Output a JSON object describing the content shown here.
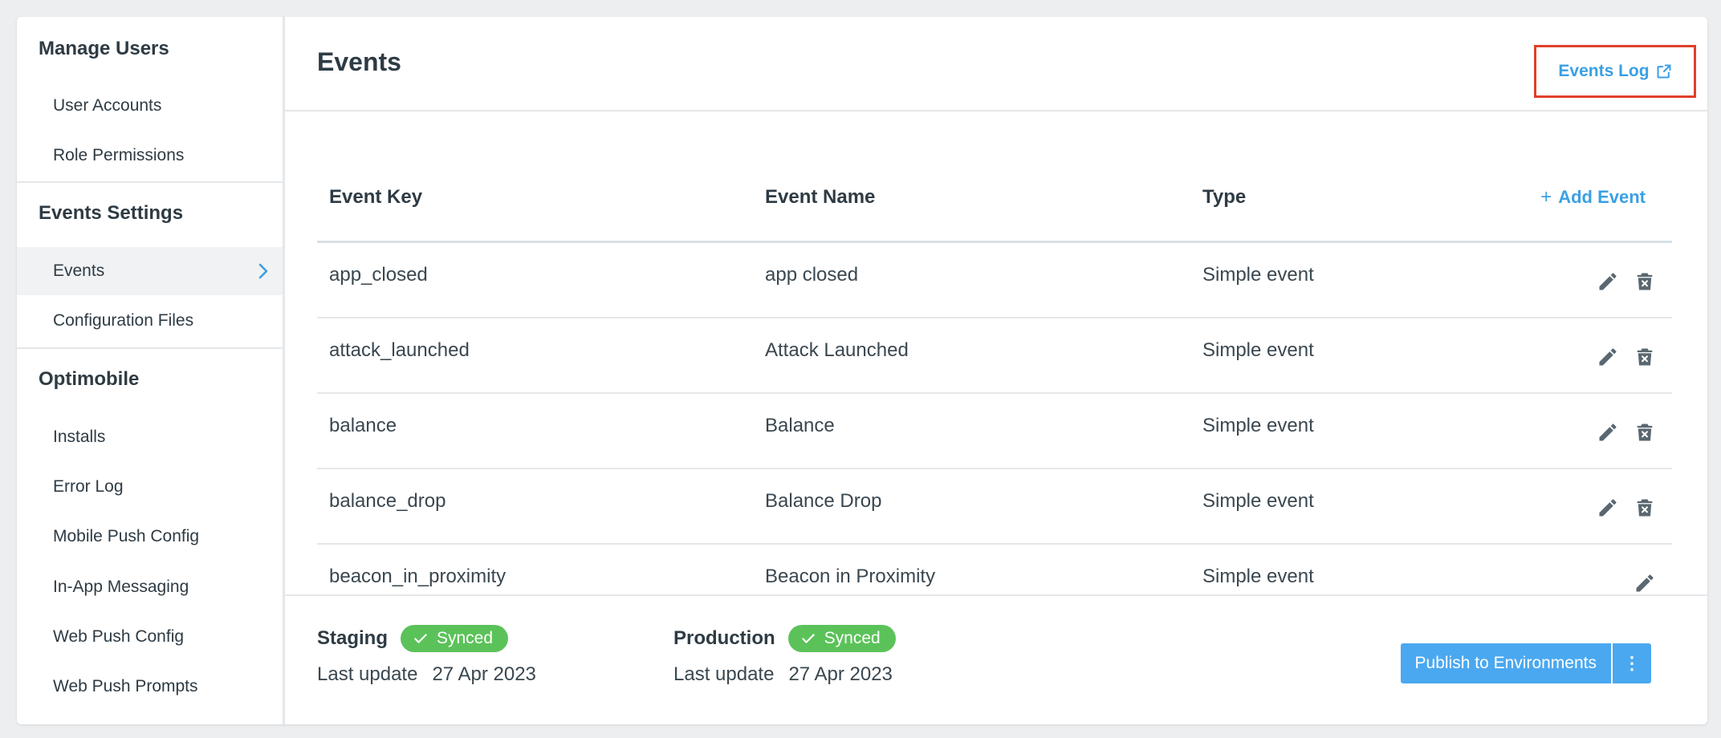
{
  "sidebar": {
    "sections": [
      {
        "title": "Manage Users",
        "items": [
          "User Accounts",
          "Role Permissions"
        ]
      },
      {
        "title": "Events Settings",
        "items": [
          "Events",
          "Configuration Files"
        ]
      },
      {
        "title": "Optimobile",
        "items": [
          "Installs",
          "Error Log",
          "Mobile Push Config",
          "In-App Messaging",
          "Web Push Config",
          "Web Push Prompts"
        ]
      }
    ],
    "active_item": "Events"
  },
  "header": {
    "title": "Events",
    "events_log_label": "Events Log"
  },
  "table": {
    "columns": [
      "Event Key",
      "Event Name",
      "Type"
    ],
    "add_label": "Add Event",
    "rows": [
      {
        "key": "app_closed",
        "name": "app closed",
        "type": "Simple event"
      },
      {
        "key": "attack_launched",
        "name": "Attack Launched",
        "type": "Simple event"
      },
      {
        "key": "balance",
        "name": "Balance",
        "type": "Simple event"
      },
      {
        "key": "balance_drop",
        "name": "Balance Drop",
        "type": "Simple event"
      },
      {
        "key": "beacon_in_proximity",
        "name": "Beacon in Proximity",
        "type": "Simple event"
      }
    ]
  },
  "footer": {
    "staging": {
      "label": "Staging",
      "status": "Synced",
      "update_label": "Last update",
      "update_date": "27 Apr 2023"
    },
    "production": {
      "label": "Production",
      "status": "Synced",
      "update_label": "Last update",
      "update_date": "27 Apr 2023"
    },
    "publish_label": "Publish to Environments",
    "more_label": "⋮"
  },
  "colors": {
    "accent": "#3aa0e4",
    "highlight_border": "#e0402a",
    "synced": "#5bc25a",
    "publish": "#4aa8f0"
  },
  "icons": [
    "chevron-right-icon",
    "external-link-icon",
    "plus-icon",
    "edit-icon",
    "delete-icon",
    "check-icon",
    "more-vertical-icon"
  ]
}
